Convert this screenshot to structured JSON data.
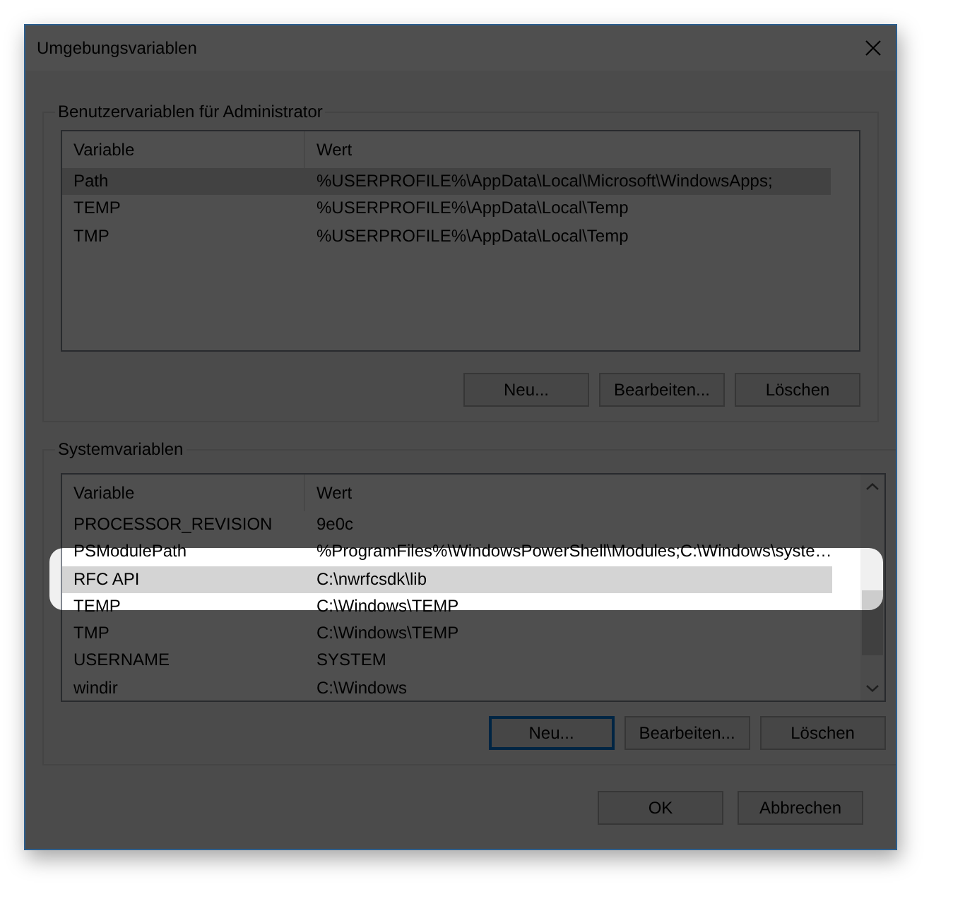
{
  "window": {
    "title": "Umgebungsvariablen"
  },
  "user_variables": {
    "title": "Benutzervariablen für Administrator",
    "columns": [
      "Variable",
      "Wert"
    ],
    "rows": [
      {
        "name": "Path",
        "value": "%USERPROFILE%\\AppData\\Local\\Microsoft\\WindowsApps;",
        "selected": true
      },
      {
        "name": "TEMP",
        "value": "%USERPROFILE%\\AppData\\Local\\Temp",
        "selected": false
      },
      {
        "name": "TMP",
        "value": "%USERPROFILE%\\AppData\\Local\\Temp",
        "selected": false
      }
    ],
    "buttons": [
      {
        "label": "Neu...",
        "focused": false
      },
      {
        "label": "Bearbeiten...",
        "focused": false
      },
      {
        "label": "Löschen",
        "focused": false
      }
    ]
  },
  "system_variables": {
    "title": "Systemvariablen",
    "columns": [
      "Variable",
      "Wert"
    ],
    "rows": [
      {
        "name": "PROCESSOR_REVISION",
        "value": "9e0c",
        "selected": false
      },
      {
        "name": "PSModulePath",
        "value": "%ProgramFiles%\\WindowsPowerShell\\Modules;C:\\Windows\\syste…",
        "selected": false
      },
      {
        "name": "RFC API",
        "value": "C:\\nwrfcsdk\\lib",
        "selected": true
      },
      {
        "name": "TEMP",
        "value": "C:\\Windows\\TEMP",
        "selected": false
      },
      {
        "name": "TMP",
        "value": "C:\\Windows\\TEMP",
        "selected": false
      },
      {
        "name": "USERNAME",
        "value": "SYSTEM",
        "selected": false
      },
      {
        "name": "windir",
        "value": "C:\\Windows",
        "selected": false
      }
    ],
    "buttons": [
      {
        "label": "Neu...",
        "focused": true
      },
      {
        "label": "Bearbeiten...",
        "focused": false
      },
      {
        "label": "Löschen",
        "focused": false
      }
    ]
  },
  "buttons": [
    "OK",
    "Abbrechen"
  ]
}
